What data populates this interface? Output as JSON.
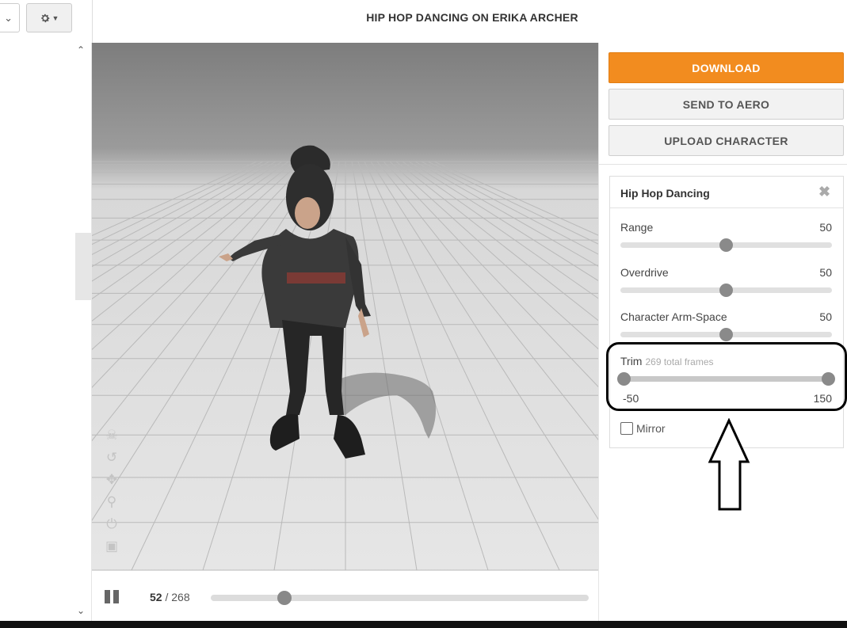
{
  "header": {
    "title": "HIP HOP DANCING ON ERIKA ARCHER",
    "dropdown_icon": "chevron-down-icon",
    "settings_icon": "gear-icon"
  },
  "actions": {
    "download_label": "DOWNLOAD",
    "send_label": "SEND TO AERO",
    "upload_label": "UPLOAD CHARACTER",
    "accent_color": "#f28c1f"
  },
  "animation_panel": {
    "title": "Hip Hop Dancing",
    "params": [
      {
        "label": "Range",
        "value": "50",
        "fraction": 0.5
      },
      {
        "label": "Overdrive",
        "value": "50",
        "fraction": 0.5
      },
      {
        "label": "Character Arm-Space",
        "value": "50",
        "fraction": 0.5
      }
    ],
    "trim": {
      "label": "Trim",
      "subtitle": "269 total frames",
      "min_value": "-50",
      "max_value": "150"
    },
    "mirror_label": "Mirror",
    "mirror_checked": false
  },
  "playback": {
    "current_frame": "52",
    "separator": "/",
    "total_frames": "268",
    "progress_fraction": 0.194
  },
  "viewport_tools": [
    "skull-icon",
    "undo-icon",
    "move-icon",
    "zoom-icon",
    "power-icon",
    "camera-icon"
  ]
}
